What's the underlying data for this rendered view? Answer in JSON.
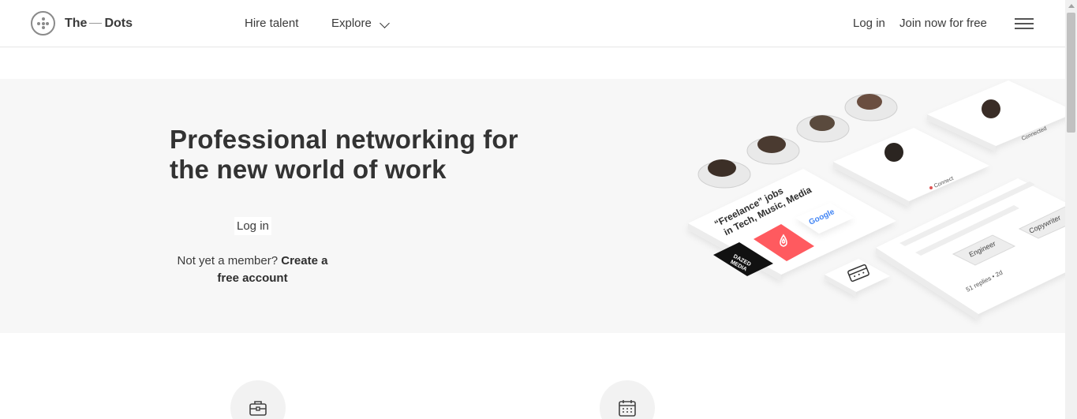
{
  "header": {
    "logo_the": "The",
    "logo_dots": "Dots",
    "nav": {
      "hire": "Hire talent",
      "explore": "Explore"
    },
    "login": "Log in",
    "join": "Join now for free"
  },
  "hero": {
    "title": "Professional networking for the new world of work",
    "login": "Log in",
    "member_prefix": "Not yet a member?",
    "member_cta": "Create a free account"
  },
  "illustration": {
    "jobs_line1": "“Freelance” jobs",
    "jobs_line2": "in Tech, Music, Media",
    "google": "Google",
    "dazed_line1": "DAZED",
    "dazed_line2": "MEDIA",
    "connect": "Connect",
    "connected": "Connected",
    "engineer": "Engineer",
    "copywriter": "Copywriter",
    "replies": "51 replies • 2d"
  },
  "icons": [
    "logo-dots-icon",
    "chevron-down-icon",
    "hamburger-menu-icon",
    "briefcase-icon",
    "calendar-icon"
  ]
}
